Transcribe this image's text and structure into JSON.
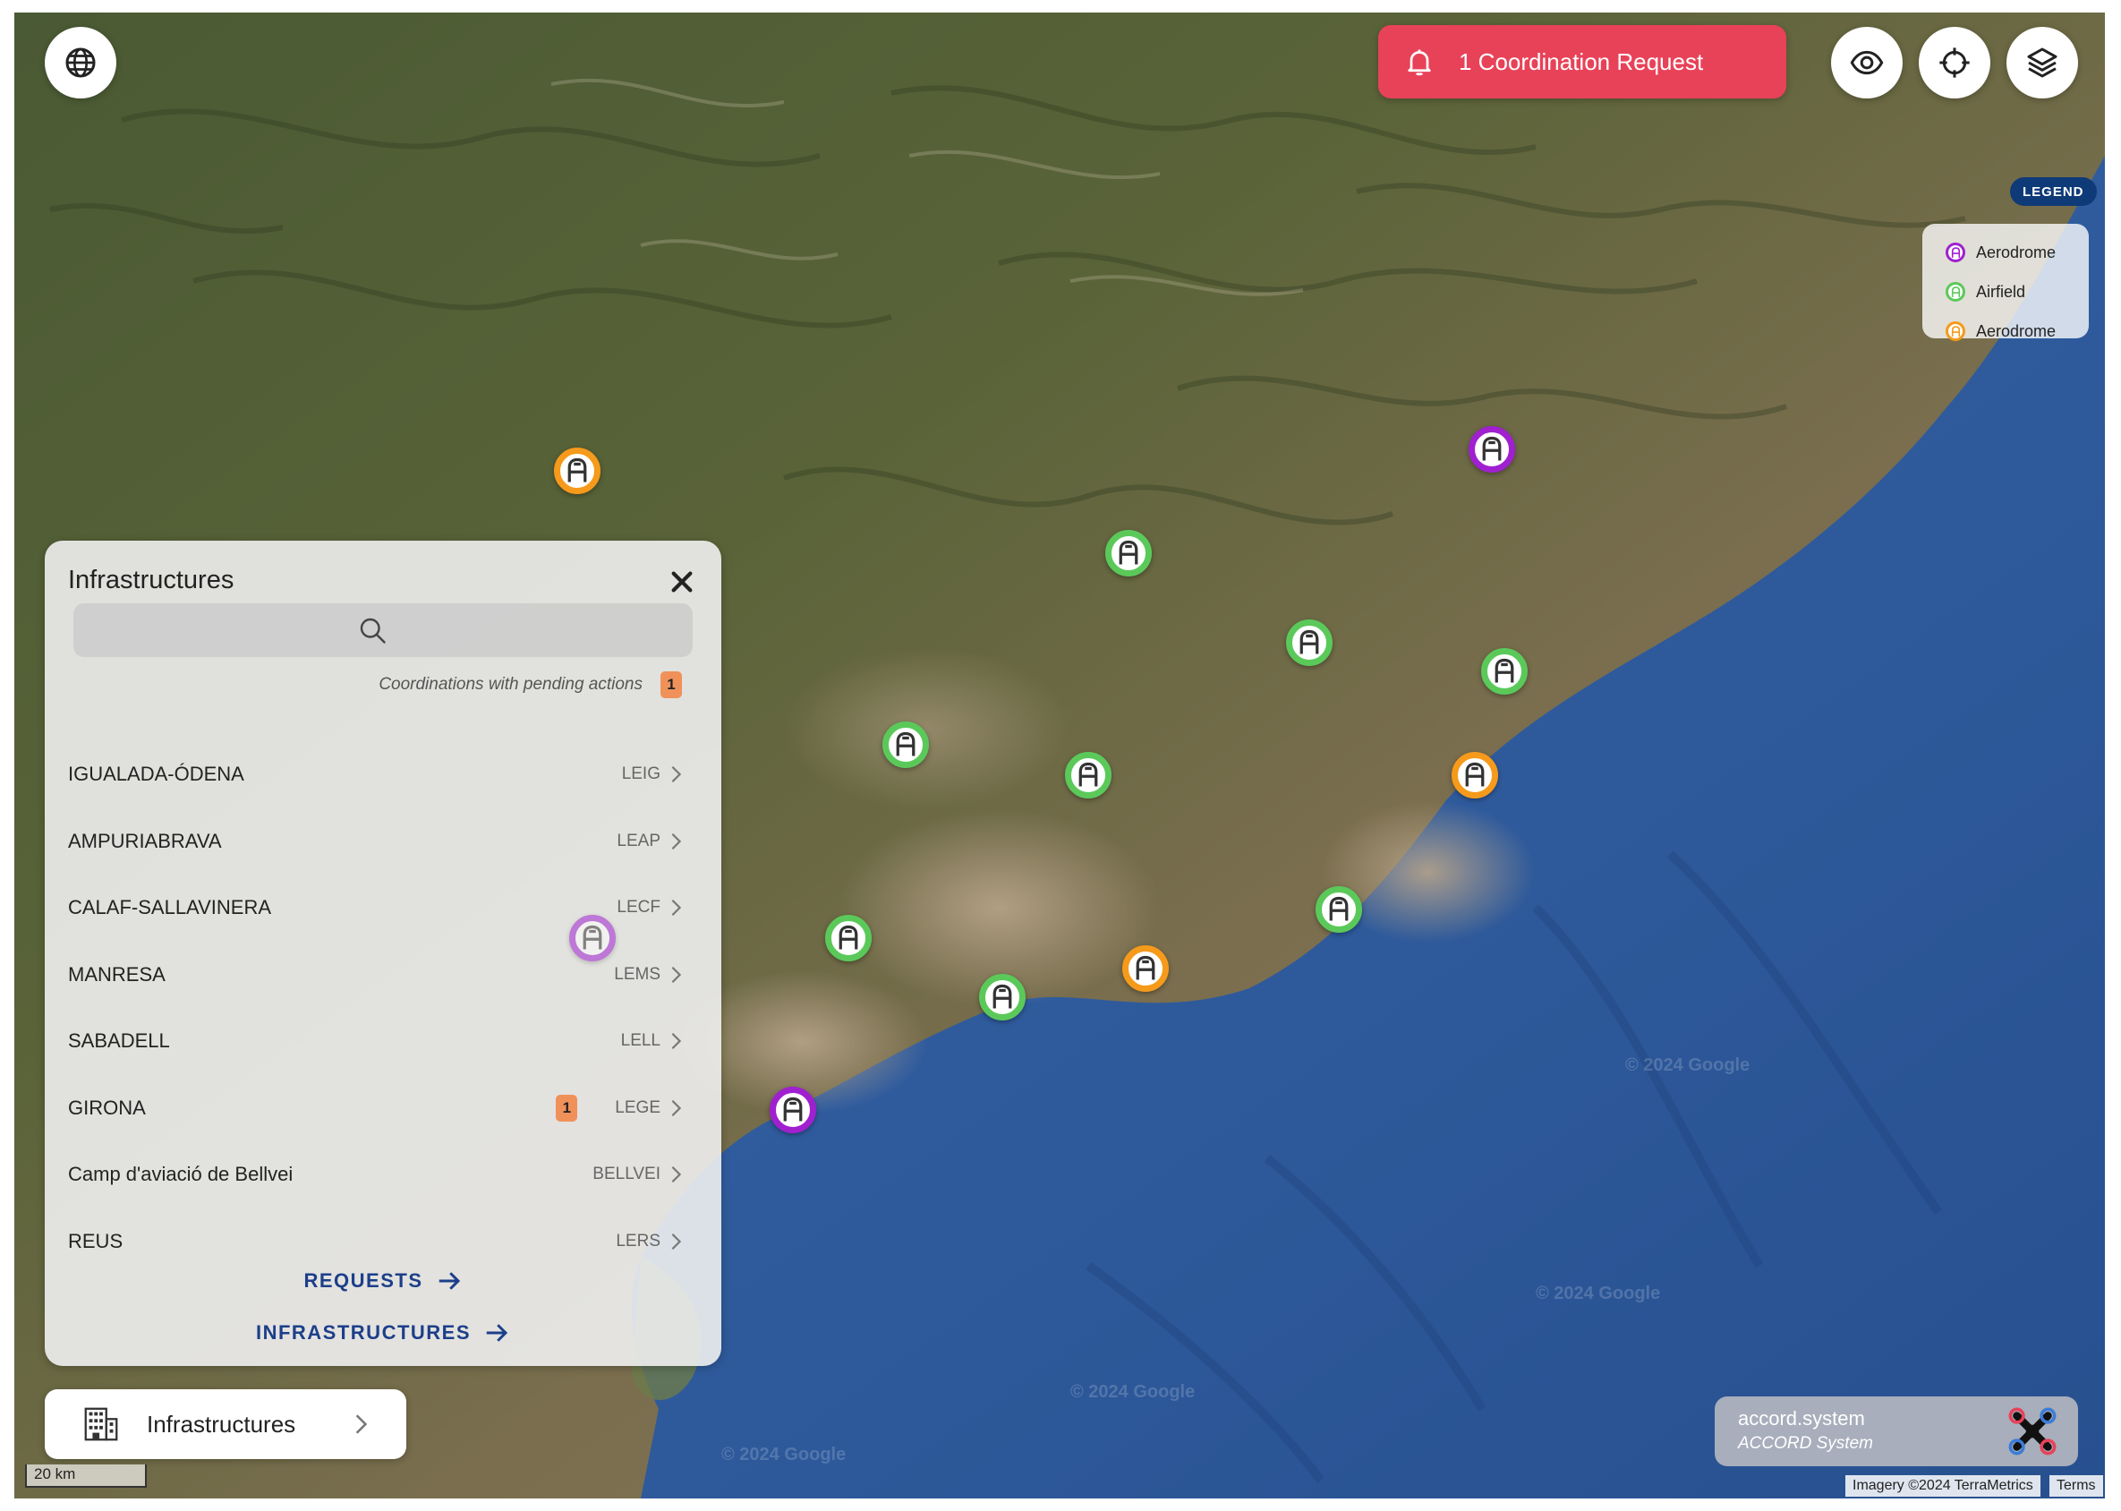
{
  "notification": {
    "label": "1 Coordination Request"
  },
  "legend": {
    "tag": "LEGEND",
    "items": [
      {
        "label": "Aerodrome",
        "color": "#a020d0"
      },
      {
        "label": "Airfield",
        "color": "#5bc95a"
      },
      {
        "label": "Aerodrome",
        "color": "#f59a1b"
      }
    ]
  },
  "panel": {
    "title": "Infrastructures",
    "search_placeholder": "",
    "pending_text": "Coordinations with pending actions",
    "pending_count": "1",
    "items": [
      {
        "name": "IGUALADA-ÓDENA",
        "code": "LEIG",
        "badge": ""
      },
      {
        "name": "AMPURIABRAVA",
        "code": "LEAP",
        "badge": ""
      },
      {
        "name": "CALAF-SALLAVINERA",
        "code": "LECF",
        "badge": ""
      },
      {
        "name": "MANRESA",
        "code": "LEMS",
        "badge": ""
      },
      {
        "name": "SABADELL",
        "code": "LELL",
        "badge": ""
      },
      {
        "name": "GIRONA",
        "code": "LEGE",
        "badge": "1"
      },
      {
        "name": "Camp d'aviació de Bellvei",
        "code": "BELLVEI",
        "badge": ""
      },
      {
        "name": "REUS",
        "code": "LERS",
        "badge": ""
      }
    ],
    "link_requests": "REQUESTS",
    "link_infrastructures": "INFRASTRUCTURES"
  },
  "bottom_button": {
    "label": "Infrastructures"
  },
  "brand": {
    "title": "accord.system",
    "subtitle": "ACCORD System"
  },
  "footer": {
    "scale": "20 km",
    "imagery": "Imagery ©2024 TerraMetrics",
    "terms": "Terms",
    "watermark": "© 2024 Google"
  },
  "colors": {
    "notification": "#e84258",
    "aerodrome_purple": "#a020d0",
    "airfield_green": "#5bc95a",
    "aerodrome_orange": "#f59a1b",
    "link": "#1c3f8a",
    "legend_tag": "#0f3a78"
  },
  "icons": {
    "globe": "globe-icon",
    "eye": "eye-icon",
    "crosshair": "crosshair-icon",
    "layers": "layers-icon",
    "bell": "bell-icon",
    "close": "close-icon",
    "search": "search-icon",
    "building": "building-icon"
  }
}
